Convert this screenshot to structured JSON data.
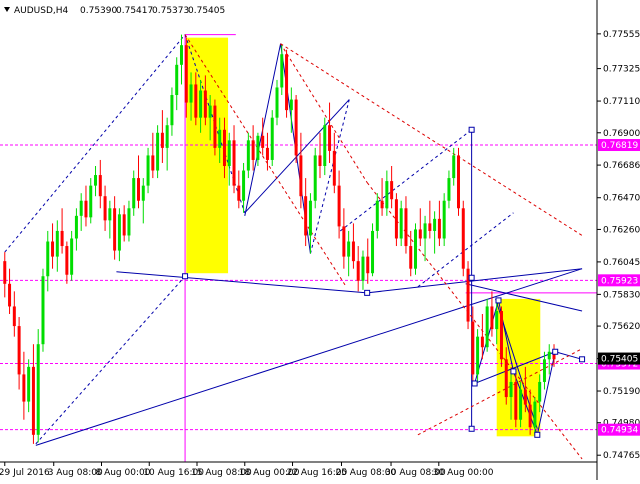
{
  "chart_data": {
    "type": "candlestick",
    "header": {
      "symbol_timeframe": "AUDUSD,H4",
      "ohlc": [
        "0.75390",
        "0.75417",
        "0.75373",
        "0.75405"
      ]
    },
    "ylim": [
      0.7472,
      0.7766
    ],
    "x_range": [
      0,
      1000
    ],
    "y_ticks": [
      "0.77555",
      "0.77325",
      "0.77110",
      "0.76900",
      "0.76686",
      "0.76470",
      "0.76260",
      "0.76045",
      "0.75830",
      "0.75620",
      "0.75405",
      "0.75190",
      "0.74980",
      "0.74765"
    ],
    "x_ticks": [
      {
        "label": "29 Jul 2016",
        "x": 8
      },
      {
        "label": "3 Aug 08:00",
        "x": 90
      },
      {
        "label": "8 Aug 00:00",
        "x": 170
      },
      {
        "label": "10 Aug 16:00",
        "x": 250
      },
      {
        "label": "15 Aug 08:00",
        "x": 330
      },
      {
        "label": "18 Aug 00:00",
        "x": 410
      },
      {
        "label": "22 Aug 16:00",
        "x": 490
      },
      {
        "label": "25 Aug 08:00",
        "x": 572
      },
      {
        "label": "30 Aug 08:00",
        "x": 655
      },
      {
        "label": "30 Aug 00:00",
        "x": 735
      }
    ],
    "price_labels": [
      {
        "value": 0.76819,
        "text": "0.76819",
        "color": "#ff00ff"
      },
      {
        "value": 0.75923,
        "text": "0.75923",
        "color": "#ff00ff"
      },
      {
        "value": 0.75372,
        "text": "0.75372",
        "color": "#ff00ff"
      },
      {
        "value": 0.74934,
        "text": "0.74934",
        "color": "#ff00ff"
      },
      {
        "value": 0.75405,
        "text": "0.75405",
        "color": "#000000"
      }
    ],
    "hlines": [
      {
        "y": 0.76819,
        "color": "#ff00ff",
        "x1": 0,
        "x2": 1000
      },
      {
        "y": 0.75923,
        "color": "#ff00ff",
        "x1": 0,
        "x2": 1000
      },
      {
        "y": 0.75372,
        "color": "#ff00ff",
        "x1": 0,
        "x2": 1000
      },
      {
        "y": 0.74934,
        "color": "#ff00ff",
        "x1": 0,
        "x2": 1000
      },
      {
        "y": 0.7755,
        "color": "#ff00ff",
        "x1": 310,
        "x2": 395
      },
      {
        "y": 0.7584,
        "color": "#ff00ff",
        "x1": 780,
        "x2": 1000
      }
    ],
    "vlines": [
      {
        "x": 310,
        "y1": 0.7472,
        "y2": 0.7755,
        "color": "#ff00ff",
        "dash": false
      },
      {
        "x": 790,
        "y1": 0.7493,
        "y2": 0.7692,
        "color": "#0000aa",
        "dash": false
      }
    ],
    "highlights": [
      {
        "x1": 312,
        "x2": 382,
        "y1": 0.7597,
        "y2": 0.7753,
        "color": "#ffff00"
      },
      {
        "x1": 832,
        "x2": 905,
        "y1": 0.7489,
        "y2": 0.758,
        "color": "#ffff00"
      }
    ],
    "lines": [
      {
        "points": [
          [
            8,
            0.7611
          ],
          [
            310,
            0.7755
          ]
        ],
        "color": "#0000aa",
        "dash": true
      },
      {
        "points": [
          [
            60,
            0.7484
          ],
          [
            310,
            0.7595
          ]
        ],
        "color": "#0000aa",
        "dash": true
      },
      {
        "points": [
          [
            60,
            0.7483
          ],
          [
            975,
            0.76
          ]
        ],
        "color": "#0000aa",
        "dash": false
      },
      {
        "points": [
          [
            195,
            0.7598
          ],
          [
            615,
            0.7584
          ]
        ],
        "color": "#0000aa",
        "dash": false
      },
      {
        "points": [
          [
            615,
            0.7584
          ],
          [
            975,
            0.76
          ]
        ],
        "color": "#0000aa",
        "dash": false
      },
      {
        "points": [
          [
            780,
            0.759
          ],
          [
            975,
            0.7572
          ]
        ],
        "color": "#0000aa",
        "dash": false
      },
      {
        "points": [
          [
            410,
            0.7637
          ],
          [
            585,
            0.7712
          ]
        ],
        "color": "#0000aa",
        "dash": false
      },
      {
        "points": [
          [
            410,
            0.7635
          ],
          [
            470,
            0.7749
          ]
        ],
        "color": "#0000aa",
        "dash": false
      },
      {
        "points": [
          [
            310,
            0.7755
          ],
          [
            410,
            0.7637
          ]
        ],
        "color": "#0000aa",
        "dash": true
      },
      {
        "points": [
          [
            470,
            0.7749
          ],
          [
            520,
            0.761
          ]
        ],
        "color": "#0000aa",
        "dash": false
      },
      {
        "points": [
          [
            520,
            0.761
          ],
          [
            585,
            0.7712
          ]
        ],
        "color": "#0000aa",
        "dash": true
      },
      {
        "points": [
          [
            570,
            0.7625
          ],
          [
            790,
            0.7692
          ]
        ],
        "color": "#0000aa",
        "dash": true
      },
      {
        "points": [
          [
            700,
            0.7588
          ],
          [
            860,
            0.7637
          ]
        ],
        "color": "#0000aa",
        "dash": true
      },
      {
        "points": [
          [
            795,
            0.7524
          ],
          [
            835,
            0.7579
          ]
        ],
        "color": "#0000aa",
        "dash": false
      },
      {
        "points": [
          [
            835,
            0.7579
          ],
          [
            860,
            0.7532
          ]
        ],
        "color": "#0000aa",
        "dash": false
      },
      {
        "points": [
          [
            860,
            0.7532
          ],
          [
            900,
            0.749
          ]
        ],
        "color": "#0000aa",
        "dash": false
      },
      {
        "points": [
          [
            900,
            0.749
          ],
          [
            930,
            0.7545
          ]
        ],
        "color": "#0000aa",
        "dash": false
      },
      {
        "points": [
          [
            930,
            0.7545
          ],
          [
            975,
            0.754
          ]
        ],
        "color": "#0000aa",
        "dash": false
      },
      {
        "points": [
          [
            795,
            0.7524
          ],
          [
            930,
            0.7545
          ]
        ],
        "color": "#0000aa",
        "dash": false
      },
      {
        "points": [
          [
            830,
            0.758
          ],
          [
            900,
            0.7494
          ]
        ],
        "color": "#0000aa",
        "dash": false
      },
      {
        "points": [
          [
            470,
            0.7749
          ],
          [
            975,
            0.7622
          ]
        ],
        "color": "#dd0000",
        "dash": true
      },
      {
        "points": [
          [
            470,
            0.7749
          ],
          [
            615,
            0.7657
          ]
        ],
        "color": "#dd0000",
        "dash": true
      },
      {
        "points": [
          [
            615,
            0.7657
          ],
          [
            975,
            0.7474
          ]
        ],
        "color": "#dd0000",
        "dash": true
      },
      {
        "points": [
          [
            700,
            0.749
          ],
          [
            975,
            0.7547
          ]
        ],
        "color": "#dd0000",
        "dash": true
      },
      {
        "points": [
          [
            310,
            0.7755
          ],
          [
            580,
            0.7588
          ]
        ],
        "color": "#dd0000",
        "dash": true
      }
    ],
    "markers": [
      {
        "x": 310,
        "y": 0.7595
      },
      {
        "x": 615,
        "y": 0.7584
      },
      {
        "x": 790,
        "y": 0.7692
      },
      {
        "x": 790,
        "y": 0.7494
      },
      {
        "x": 795,
        "y": 0.7524
      },
      {
        "x": 835,
        "y": 0.7579
      },
      {
        "x": 860,
        "y": 0.7532
      },
      {
        "x": 900,
        "y": 0.749
      },
      {
        "x": 930,
        "y": 0.7545
      },
      {
        "x": 975,
        "y": 0.754
      },
      {
        "x": 790,
        "y": 0.7594
      }
    ],
    "candles": [
      [
        8,
        0.7605,
        0.7611,
        0.7581,
        0.759
      ],
      [
        16,
        0.759,
        0.76,
        0.757,
        0.7575
      ],
      [
        24,
        0.7575,
        0.7585,
        0.7555,
        0.7562
      ],
      [
        32,
        0.7562,
        0.7568,
        0.752,
        0.753
      ],
      [
        40,
        0.753,
        0.7545,
        0.75,
        0.7512
      ],
      [
        48,
        0.7512,
        0.754,
        0.7505,
        0.7535
      ],
      [
        56,
        0.7535,
        0.755,
        0.7484,
        0.749
      ],
      [
        64,
        0.749,
        0.756,
        0.7485,
        0.755
      ],
      [
        72,
        0.755,
        0.76,
        0.7545,
        0.7595
      ],
      [
        80,
        0.7595,
        0.7625,
        0.7585,
        0.7618
      ],
      [
        88,
        0.7618,
        0.763,
        0.76,
        0.7608
      ],
      [
        96,
        0.7608,
        0.7632,
        0.7598,
        0.7625
      ],
      [
        104,
        0.7625,
        0.764,
        0.761,
        0.7615
      ],
      [
        112,
        0.7615,
        0.7618,
        0.759,
        0.7596
      ],
      [
        120,
        0.7596,
        0.7625,
        0.7592,
        0.762
      ],
      [
        128,
        0.762,
        0.764,
        0.7612,
        0.7635
      ],
      [
        136,
        0.7635,
        0.765,
        0.7625,
        0.7645
      ],
      [
        144,
        0.7645,
        0.7655,
        0.7628,
        0.7634
      ],
      [
        152,
        0.7634,
        0.766,
        0.763,
        0.7655
      ],
      [
        160,
        0.7655,
        0.7668,
        0.7648,
        0.7662
      ],
      [
        168,
        0.7662,
        0.7672,
        0.764,
        0.7648
      ],
      [
        176,
        0.7648,
        0.7655,
        0.7625,
        0.7632
      ],
      [
        184,
        0.7632,
        0.7645,
        0.762,
        0.764
      ],
      [
        192,
        0.764,
        0.7648,
        0.7606,
        0.7612
      ],
      [
        200,
        0.7612,
        0.764,
        0.7605,
        0.7636
      ],
      [
        208,
        0.7636,
        0.7642,
        0.7618,
        0.7622
      ],
      [
        216,
        0.7622,
        0.7645,
        0.7618,
        0.764
      ],
      [
        224,
        0.764,
        0.7665,
        0.7635,
        0.766
      ],
      [
        232,
        0.766,
        0.7675,
        0.764,
        0.7645
      ],
      [
        240,
        0.7645,
        0.766,
        0.763,
        0.7655
      ],
      [
        248,
        0.7655,
        0.768,
        0.765,
        0.7675
      ],
      [
        256,
        0.7675,
        0.769,
        0.766,
        0.7665
      ],
      [
        264,
        0.7665,
        0.7695,
        0.766,
        0.769
      ],
      [
        272,
        0.769,
        0.7705,
        0.767,
        0.768
      ],
      [
        280,
        0.768,
        0.77,
        0.7665,
        0.7695
      ],
      [
        288,
        0.7695,
        0.772,
        0.7688,
        0.7715
      ],
      [
        296,
        0.7715,
        0.774,
        0.7705,
        0.7735
      ],
      [
        304,
        0.7735,
        0.7755,
        0.7722,
        0.7748
      ],
      [
        312,
        0.7748,
        0.7753,
        0.77,
        0.771
      ],
      [
        320,
        0.771,
        0.773,
        0.7698,
        0.7722
      ],
      [
        328,
        0.7722,
        0.773,
        0.7695,
        0.77
      ],
      [
        336,
        0.77,
        0.7725,
        0.769,
        0.7718
      ],
      [
        344,
        0.7718,
        0.7728,
        0.7695,
        0.77
      ],
      [
        352,
        0.77,
        0.7715,
        0.7685,
        0.7708
      ],
      [
        360,
        0.7708,
        0.7712,
        0.7675,
        0.768
      ],
      [
        368,
        0.768,
        0.77,
        0.767,
        0.7692
      ],
      [
        376,
        0.7692,
        0.77,
        0.766,
        0.7668
      ],
      [
        384,
        0.7668,
        0.769,
        0.7655,
        0.7685
      ],
      [
        392,
        0.7685,
        0.7695,
        0.765,
        0.7655
      ],
      [
        400,
        0.7655,
        0.7665,
        0.764,
        0.7645
      ],
      [
        408,
        0.7645,
        0.767,
        0.7637,
        0.7665
      ],
      [
        416,
        0.7665,
        0.769,
        0.766,
        0.7685
      ],
      [
        424,
        0.7685,
        0.7695,
        0.7665,
        0.7672
      ],
      [
        432,
        0.7672,
        0.769,
        0.7668,
        0.7688
      ],
      [
        440,
        0.7688,
        0.77,
        0.7675,
        0.768
      ],
      [
        448,
        0.768,
        0.769,
        0.7665,
        0.7672
      ],
      [
        456,
        0.7672,
        0.7705,
        0.7668,
        0.77
      ],
      [
        464,
        0.77,
        0.7725,
        0.7695,
        0.772
      ],
      [
        472,
        0.772,
        0.7748,
        0.7715,
        0.7742
      ],
      [
        480,
        0.7742,
        0.7745,
        0.77,
        0.7705
      ],
      [
        488,
        0.7705,
        0.772,
        0.769,
        0.7712
      ],
      [
        496,
        0.7712,
        0.7715,
        0.767,
        0.7675
      ],
      [
        504,
        0.7675,
        0.769,
        0.764,
        0.7648
      ],
      [
        512,
        0.7648,
        0.766,
        0.7615,
        0.7622
      ],
      [
        520,
        0.7622,
        0.765,
        0.761,
        0.7645
      ],
      [
        528,
        0.7645,
        0.768,
        0.764,
        0.7675
      ],
      [
        536,
        0.7675,
        0.769,
        0.766,
        0.7668
      ],
      [
        544,
        0.7668,
        0.77,
        0.7662,
        0.7695
      ],
      [
        552,
        0.7695,
        0.771,
        0.767,
        0.7678
      ],
      [
        560,
        0.7678,
        0.769,
        0.765,
        0.7655
      ],
      [
        568,
        0.7655,
        0.7665,
        0.762,
        0.7628
      ],
      [
        576,
        0.7628,
        0.764,
        0.76,
        0.7608
      ],
      [
        584,
        0.7608,
        0.7625,
        0.7595,
        0.7618
      ],
      [
        592,
        0.7618,
        0.763,
        0.76,
        0.7605
      ],
      [
        600,
        0.7605,
        0.7615,
        0.7585,
        0.7592
      ],
      [
        608,
        0.7592,
        0.7612,
        0.7586,
        0.7608
      ],
      [
        616,
        0.7608,
        0.762,
        0.759,
        0.7597
      ],
      [
        624,
        0.7597,
        0.763,
        0.7595,
        0.7625
      ],
      [
        632,
        0.7625,
        0.765,
        0.762,
        0.7645
      ],
      [
        640,
        0.7645,
        0.766,
        0.7635,
        0.764
      ],
      [
        648,
        0.764,
        0.7665,
        0.7635,
        0.7658
      ],
      [
        656,
        0.7658,
        0.7668,
        0.764,
        0.7646
      ],
      [
        664,
        0.7646,
        0.765,
        0.7615,
        0.762
      ],
      [
        672,
        0.762,
        0.7645,
        0.7615,
        0.764
      ],
      [
        680,
        0.764,
        0.7648,
        0.761,
        0.7615
      ],
      [
        688,
        0.7615,
        0.7625,
        0.7595,
        0.76
      ],
      [
        696,
        0.76,
        0.763,
        0.7596,
        0.7626
      ],
      [
        704,
        0.7626,
        0.764,
        0.7615,
        0.762
      ],
      [
        712,
        0.762,
        0.7635,
        0.7605,
        0.763
      ],
      [
        720,
        0.763,
        0.7645,
        0.762,
        0.7625
      ],
      [
        728,
        0.7625,
        0.7638,
        0.761,
        0.7633
      ],
      [
        736,
        0.7633,
        0.7645,
        0.7615,
        0.762
      ],
      [
        744,
        0.762,
        0.765,
        0.7615,
        0.7645
      ],
      [
        752,
        0.7645,
        0.7665,
        0.764,
        0.766
      ],
      [
        760,
        0.766,
        0.768,
        0.7655,
        0.7675
      ],
      [
        768,
        0.7675,
        0.768,
        0.7635,
        0.764
      ],
      [
        776,
        0.764,
        0.7645,
        0.7595,
        0.76
      ],
      [
        784,
        0.76,
        0.7605,
        0.756,
        0.7565
      ],
      [
        792,
        0.7565,
        0.7575,
        0.7525,
        0.753
      ],
      [
        800,
        0.753,
        0.756,
        0.7525,
        0.7555
      ],
      [
        808,
        0.7555,
        0.757,
        0.754,
        0.7548
      ],
      [
        816,
        0.7548,
        0.758,
        0.7545,
        0.7575
      ],
      [
        824,
        0.7575,
        0.7585,
        0.7555,
        0.756
      ],
      [
        832,
        0.756,
        0.7578,
        0.755,
        0.7572
      ],
      [
        840,
        0.7572,
        0.7575,
        0.7535,
        0.754
      ],
      [
        848,
        0.754,
        0.7548,
        0.751,
        0.7515
      ],
      [
        856,
        0.7515,
        0.753,
        0.75,
        0.7525
      ],
      [
        864,
        0.7525,
        0.753,
        0.7495,
        0.75
      ],
      [
        872,
        0.75,
        0.7525,
        0.7495,
        0.752
      ],
      [
        880,
        0.752,
        0.7535,
        0.7505,
        0.751
      ],
      [
        888,
        0.751,
        0.752,
        0.749,
        0.7495
      ],
      [
        896,
        0.7495,
        0.7515,
        0.749,
        0.7512
      ],
      [
        904,
        0.7512,
        0.753,
        0.7505,
        0.7525
      ],
      [
        912,
        0.7525,
        0.7545,
        0.752,
        0.754
      ],
      [
        920,
        0.754,
        0.755,
        0.753,
        0.7545
      ],
      [
        928,
        0.7545,
        0.755,
        0.7535,
        0.754
      ]
    ],
    "colors": {
      "bull": "#00dd00",
      "bear": "#ff0000",
      "axis": "#000000",
      "current_label_bg": "#000000",
      "label_text": "#ffffff"
    },
    "grid": false
  }
}
